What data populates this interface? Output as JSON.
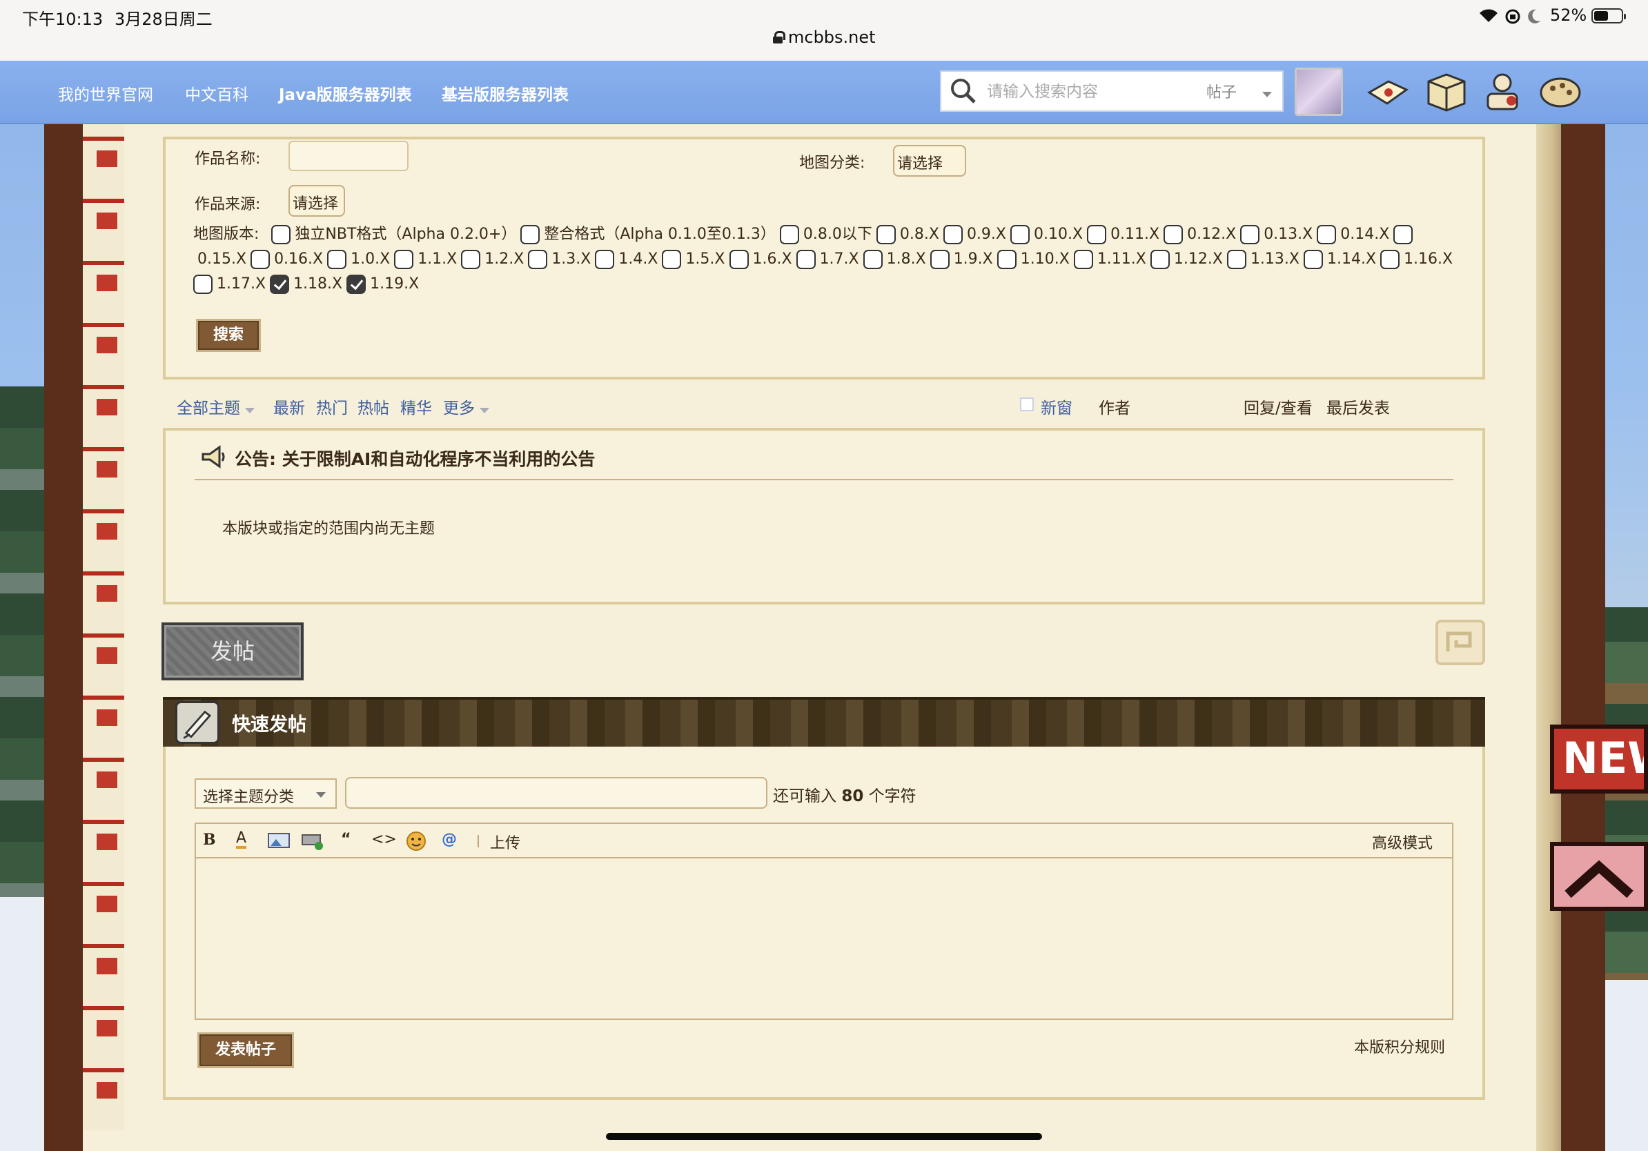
{
  "status_bar": {
    "time": "下午10:13",
    "date": "3月28日周二",
    "url": "mcbbs.net",
    "battery": "52%",
    "battery_level": 0.52
  },
  "nav": {
    "links": [
      "我的世界官网",
      "中文百科",
      "Java版服务器列表",
      "基岩版服务器列表"
    ],
    "search_placeholder": "请输入搜索内容",
    "search_type": "帖子"
  },
  "filter": {
    "name_label": "作品名称:",
    "category_label": "地图分类:",
    "category_value": "请选择",
    "source_label": "作品来源:",
    "source_value": "请选择",
    "version_label": "地图版本:",
    "versions": [
      {
        "label": "独立NBT格式（Alpha 0.2.0+）",
        "checked": false
      },
      {
        "label": "整合格式（Alpha 0.1.0至0.1.3）",
        "checked": false
      },
      {
        "label": "0.8.0以下",
        "checked": false
      },
      {
        "label": "0.8.X",
        "checked": false
      },
      {
        "label": "0.9.X",
        "checked": false
      },
      {
        "label": "0.10.X",
        "checked": false
      },
      {
        "label": "0.11.X",
        "checked": false
      },
      {
        "label": "0.12.X",
        "checked": false
      },
      {
        "label": "0.13.X",
        "checked": false
      },
      {
        "label": "0.14.X",
        "checked": false
      },
      {
        "label": "0.15.X",
        "checked": false
      },
      {
        "label": "0.16.X",
        "checked": false
      },
      {
        "label": "1.0.X",
        "checked": false
      },
      {
        "label": "1.1.X",
        "checked": false
      },
      {
        "label": "1.2.X",
        "checked": false
      },
      {
        "label": "1.3.X",
        "checked": false
      },
      {
        "label": "1.4.X",
        "checked": false
      },
      {
        "label": "1.5.X",
        "checked": false
      },
      {
        "label": "1.6.X",
        "checked": false
      },
      {
        "label": "1.7.X",
        "checked": false
      },
      {
        "label": "1.8.X",
        "checked": false
      },
      {
        "label": "1.9.X",
        "checked": false
      },
      {
        "label": "1.10.X",
        "checked": false
      },
      {
        "label": "1.11.X",
        "checked": false
      },
      {
        "label": "1.12.X",
        "checked": false
      },
      {
        "label": "1.13.X",
        "checked": false
      },
      {
        "label": "1.14.X",
        "checked": false
      },
      {
        "label": "1.16.X",
        "checked": false
      },
      {
        "label": "1.17.X",
        "checked": false
      },
      {
        "label": "1.18.X",
        "checked": true
      },
      {
        "label": "1.19.X",
        "checked": true
      }
    ],
    "search_button": "搜索"
  },
  "tabs": {
    "all": "全部主题",
    "latest": "最新",
    "hot": "热门",
    "hot_post": "热帖",
    "digest": "精华",
    "more": "更多",
    "new_window": "新窗",
    "author": "作者",
    "reply_view": "回复/查看",
    "last_post": "最后发表"
  },
  "notice": {
    "title": "公告: 关于限制AI和自动化程序不当利用的公告",
    "empty": "本版块或指定的范围内尚无主题"
  },
  "post_button": "发帖",
  "quick_post": {
    "title": "快速发帖",
    "category_select": "选择主题分类",
    "hint_prefix": "还可输入",
    "hint_count": "80",
    "hint_suffix": "个字符",
    "upload": "上传",
    "advanced": "高级模式",
    "submit": "发表帖子",
    "rules": "本版积分规则"
  },
  "side_tag": "NEW"
}
